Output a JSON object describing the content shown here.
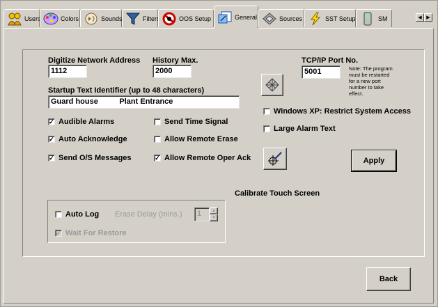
{
  "tabs": [
    {
      "label": "Users",
      "icon": "users-icon"
    },
    {
      "label": "Colors",
      "icon": "palette-icon"
    },
    {
      "label": "Sounds",
      "icon": "sounds-icon"
    },
    {
      "label": "Filters",
      "icon": "filter-icon"
    },
    {
      "label": "OOS Setup",
      "icon": "no-entry-icon"
    },
    {
      "label": "General",
      "icon": "general-icon"
    },
    {
      "label": "Sources",
      "icon": "sources-icon"
    },
    {
      "label": "SST Setup",
      "icon": "lightning-icon"
    },
    {
      "label": "SM",
      "icon": "device-icon"
    }
  ],
  "general": {
    "digitize_label": "Digitize Network Address",
    "digitize_value": "1112",
    "history_label": "History Max.",
    "history_value": "2000",
    "tcp_label": "TCP/IP Port No.",
    "tcp_value": "5001",
    "tcp_note": "Note: The program must be restarted for a new port number to take effect.",
    "startup_label": "Startup Text Identifier (up to 48 characters)",
    "startup_value": "Guard house          Plant Entrance",
    "checkboxes": {
      "audible_alarms": {
        "label": "Audible Alarms",
        "checked": true
      },
      "auto_acknowledge": {
        "label": "Auto Acknowledge",
        "checked": true
      },
      "send_os_messages": {
        "label": "Send O/S Messages",
        "checked": true
      },
      "send_time_signal": {
        "label": "Send Time Signal",
        "checked": false
      },
      "allow_remote_erase": {
        "label": "Allow Remote Erase",
        "checked": false
      },
      "allow_remote_oper_ack": {
        "label": "Allow Remote Oper Ack",
        "checked": true
      },
      "windows_xp": {
        "label": "Windows XP: Restrict System Access",
        "checked": false
      },
      "large_alarm_text": {
        "label": "Large Alarm Text",
        "checked": false
      },
      "auto_log": {
        "label": "Auto Log",
        "checked": false
      },
      "wait_for_restore": {
        "label": "Wait For Restore",
        "checked": true
      }
    },
    "erase_delay_label": "Erase Delay (mins.)",
    "erase_delay_value": "1",
    "calibrate_label": "Calibrate Touch Screen",
    "apply_label": "Apply"
  },
  "back_label": "Back"
}
